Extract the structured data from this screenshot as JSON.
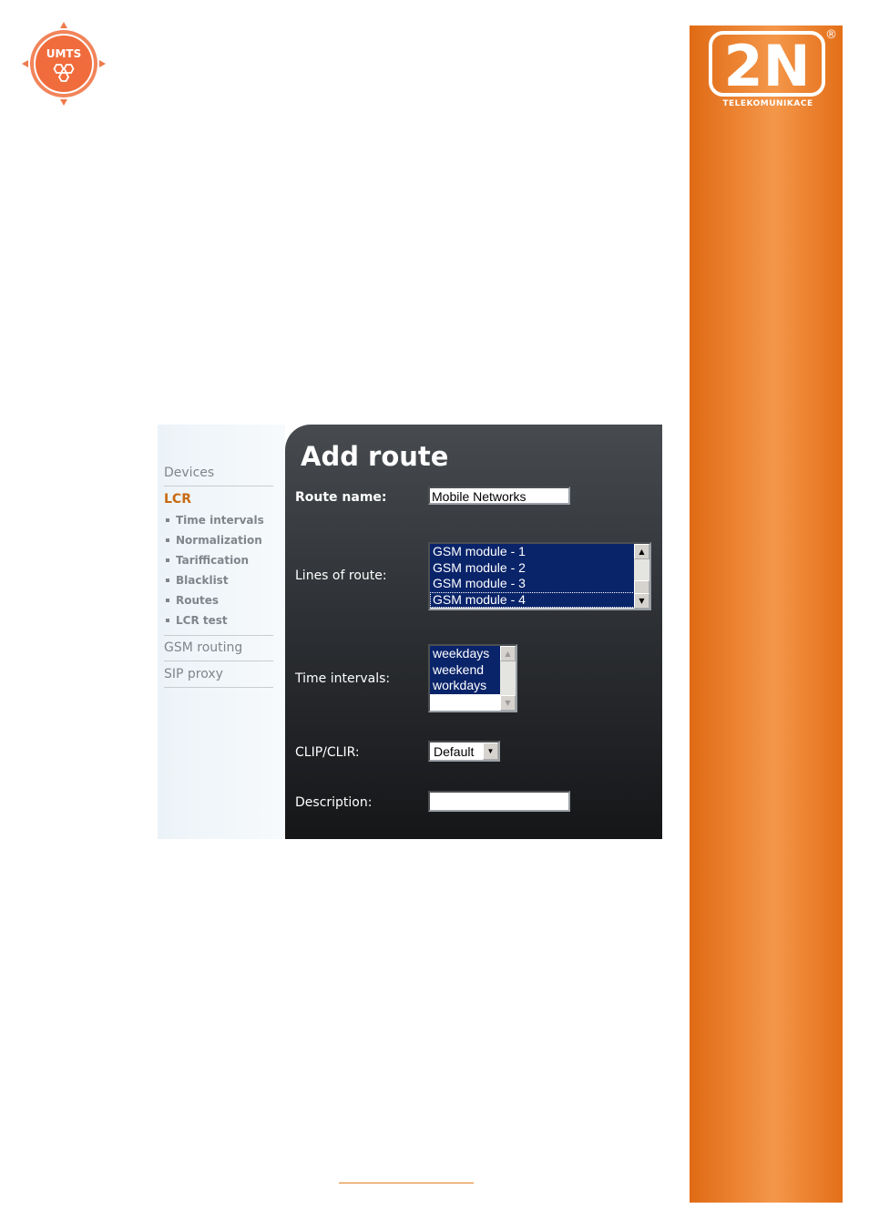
{
  "brand": {
    "umts_text": "UMTS",
    "logo_text": "2N",
    "registered": "®",
    "subtitle": "TELEKOMUNIKACE",
    "orange": "#e6721a"
  },
  "sidebar": {
    "items": [
      {
        "label": "Devices"
      },
      {
        "label": "LCR",
        "active": true
      },
      {
        "label": "Time intervals"
      },
      {
        "label": "Normalization"
      },
      {
        "label": "Tariffication"
      },
      {
        "label": "Blacklist"
      },
      {
        "label": "Routes"
      },
      {
        "label": "LCR test"
      },
      {
        "label": "GSM routing"
      },
      {
        "label": "SIP proxy"
      }
    ]
  },
  "form": {
    "title": "Add route",
    "route_name": {
      "label": "Route name:",
      "value": "Mobile Networks"
    },
    "lines": {
      "label": "Lines of route:",
      "options": [
        "GSM module - 1",
        "GSM module - 2",
        "GSM module - 3",
        "GSM module - 4"
      ]
    },
    "time_intervals": {
      "label": "Time intervals:",
      "options": [
        "weekdays",
        "weekend",
        "workdays"
      ]
    },
    "clip_clir": {
      "label": "CLIP/CLIR:",
      "value": "Default"
    },
    "description": {
      "label": "Description:",
      "value": ""
    }
  }
}
